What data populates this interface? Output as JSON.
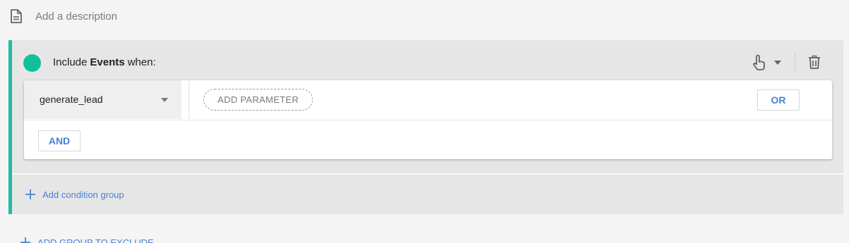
{
  "description": {
    "placeholder": "Add a description",
    "icon": "document-icon"
  },
  "group": {
    "accent_color": "#12bf9d",
    "header": {
      "prefix": "Include",
      "keyword": "Events",
      "suffix": "when:"
    },
    "condition": {
      "event_name": "generate_lead",
      "add_parameter_label": "ADD PARAMETER",
      "or_label": "OR",
      "and_label": "AND"
    },
    "add_condition_group_label": "Add condition group"
  },
  "exclude": {
    "label": "ADD GROUP TO EXCLUDE"
  },
  "colors": {
    "link_blue": "#4a7fd6",
    "background": "#f4f4f4"
  }
}
